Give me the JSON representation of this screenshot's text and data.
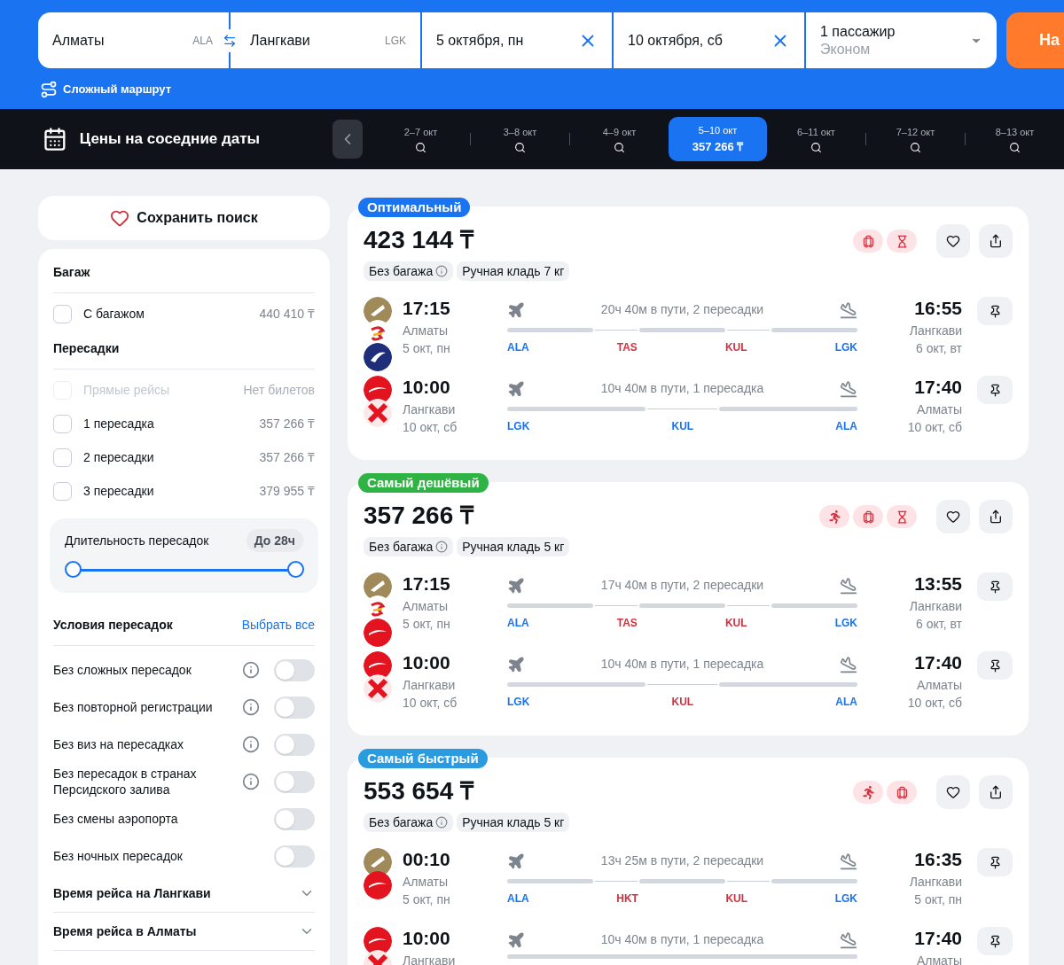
{
  "search": {
    "origin": {
      "city": "Алматы",
      "code": "ALA"
    },
    "destination": {
      "city": "Лангкави",
      "code": "LGK"
    },
    "date_there": "5 октября, пн",
    "date_back": "10 октября, сб",
    "passengers": "1 пассажир",
    "cabin": "Эконом",
    "submit": "На",
    "complex_route": "Сложный маршрут"
  },
  "dates_bar": {
    "title": "Цены на соседние даты",
    "dates": [
      {
        "label": "2–7 окт",
        "selected": false
      },
      {
        "label": "3–8 окт",
        "selected": false
      },
      {
        "label": "4–9 окт",
        "selected": false
      },
      {
        "label": "5–10 окт",
        "price": "357 266 ₸",
        "selected": true
      },
      {
        "label": "6–11 окт",
        "selected": false
      },
      {
        "label": "7–12 окт",
        "selected": false
      },
      {
        "label": "8–13 окт",
        "selected": false
      }
    ]
  },
  "sidebar": {
    "save_search": "Сохранить поиск",
    "baggage": {
      "title": "Багаж",
      "options": [
        {
          "label": "С багажом",
          "price": "440 410 ₸",
          "checked": false,
          "disabled": false
        }
      ]
    },
    "transfers": {
      "title": "Пересадки",
      "options": [
        {
          "label": "Прямые рейсы",
          "price": "Нет билетов",
          "checked": false,
          "disabled": true
        },
        {
          "label": "1 пересадка",
          "price": "357 266 ₸",
          "checked": false,
          "disabled": false
        },
        {
          "label": "2 пересадки",
          "price": "357 266 ₸",
          "checked": false,
          "disabled": false
        },
        {
          "label": "3 пересадки",
          "price": "379 955 ₸",
          "checked": false,
          "disabled": false
        }
      ]
    },
    "duration": {
      "label": "Длительность пересадок",
      "value": "До 28ч",
      "thumbs": [
        {
          "level": 0
        },
        {
          "level": 1
        }
      ]
    },
    "conditions": {
      "title": "Условия пересадок",
      "select_all": "Выбрать все",
      "items": [
        {
          "label": "Без сложных пересадок",
          "info": true,
          "on": false
        },
        {
          "label": "Без повторной регистрации",
          "info": true,
          "on": false
        },
        {
          "label": "Без виз на пересадках",
          "info": true,
          "on": false
        },
        {
          "label": "Без пересадок в странах Персидского залива",
          "info": true,
          "on": false
        },
        {
          "label": "Без смены аэропорта",
          "info": false,
          "on": false
        },
        {
          "label": "Без ночных пересадок",
          "info": false,
          "on": false
        }
      ]
    },
    "sections": [
      {
        "title": "Время рейса на Лангкави",
        "expanded": false
      },
      {
        "title": "Время рейса в Алматы",
        "expanded": false
      }
    ]
  },
  "results": [
    {
      "tag": "Оптимальный",
      "color": "#1a73f0",
      "price": "423 144 ₸",
      "warnings": [
        {
          "kind": "luggage"
        },
        {
          "kind": "hourglass"
        }
      ],
      "chips": [
        "Без багажа",
        "Ручная кладь 7 кг"
      ],
      "legs": [
        {
          "logos": [
            {
              "kind": "gold"
            },
            {
              "kind": "swirl"
            },
            {
              "kind": "navy"
            }
          ],
          "dep_time": "17:15",
          "dep_city": "Алматы",
          "dep_date": "5 окт, пн",
          "duration": "20ч 40м в пути, 2 пересадки",
          "arr_time": "16:55",
          "arr_city": "Лангкави",
          "arr_date": "6 окт, вт",
          "codes": [
            {
              "code": "ALA",
              "color": "#1a73f0"
            },
            {
              "code": "TAS",
              "color": "#d0333f"
            },
            {
              "code": "KUL",
              "color": "#d0333f"
            },
            {
              "code": "LGK",
              "color": "#1a73f0"
            }
          ]
        },
        {
          "logos": [
            {
              "kind": "red"
            },
            {
              "kind": "redx"
            }
          ],
          "dep_time": "10:00",
          "dep_city": "Лангкави",
          "dep_date": "10 окт, сб",
          "duration": "10ч 40м в пути, 1 пересадка",
          "arr_time": "17:40",
          "arr_city": "Алматы",
          "arr_date": "10 окт, сб",
          "codes": [
            {
              "code": "LGK",
              "color": "#1a73f0"
            },
            {
              "code": "KUL",
              "color": "#1a73f0"
            },
            {
              "code": "ALA",
              "color": "#1a73f0"
            }
          ]
        }
      ]
    },
    {
      "tag": "Самый дешёвый",
      "color": "#2fb344",
      "price": "357 266 ₸",
      "warnings": [
        {
          "kind": "run"
        },
        {
          "kind": "luggage"
        },
        {
          "kind": "hourglass"
        }
      ],
      "chips": [
        "Без багажа",
        "Ручная кладь 5 кг"
      ],
      "legs": [
        {
          "logos": [
            {
              "kind": "gold"
            },
            {
              "kind": "swirl"
            },
            {
              "kind": "red"
            }
          ],
          "dep_time": "17:15",
          "dep_city": "Алматы",
          "dep_date": "5 окт, пн",
          "duration": "17ч 40м в пути, 2 пересадки",
          "arr_time": "13:55",
          "arr_city": "Лангкави",
          "arr_date": "6 окт, вт",
          "codes": [
            {
              "code": "ALA",
              "color": "#1a73f0"
            },
            {
              "code": "TAS",
              "color": "#d0333f"
            },
            {
              "code": "KUL",
              "color": "#d0333f"
            },
            {
              "code": "LGK",
              "color": "#1a73f0"
            }
          ]
        },
        {
          "logos": [
            {
              "kind": "red"
            },
            {
              "kind": "redx"
            }
          ],
          "dep_time": "10:00",
          "dep_city": "Лангкави",
          "dep_date": "10 окт, сб",
          "duration": "10ч 40м в пути, 1 пересадка",
          "arr_time": "17:40",
          "arr_city": "Алматы",
          "arr_date": "10 окт, сб",
          "codes": [
            {
              "code": "LGK",
              "color": "#1a73f0"
            },
            {
              "code": "KUL",
              "color": "#d0333f"
            },
            {
              "code": "ALA",
              "color": "#1a73f0"
            }
          ]
        }
      ]
    },
    {
      "tag": "Самый быстрый",
      "color": "#2b9be0",
      "price": "553 654 ₸",
      "warnings": [
        {
          "kind": "run"
        },
        {
          "kind": "luggage"
        }
      ],
      "chips": [
        "Без багажа",
        "Ручная кладь 5 кг"
      ],
      "legs": [
        {
          "logos": [
            {
              "kind": "gold"
            },
            {
              "kind": "red"
            }
          ],
          "dep_time": "00:10",
          "dep_city": "Алматы",
          "dep_date": "5 окт, пн",
          "duration": "13ч 25м в пути, 2 пересадки",
          "arr_time": "16:35",
          "arr_city": "Лангкави",
          "arr_date": "5 окт, пн",
          "codes": [
            {
              "code": "ALA",
              "color": "#1a73f0"
            },
            {
              "code": "HKT",
              "color": "#d0333f"
            },
            {
              "code": "KUL",
              "color": "#d0333f"
            },
            {
              "code": "LGK",
              "color": "#1a73f0"
            }
          ]
        },
        {
          "logos": [
            {
              "kind": "red"
            },
            {
              "kind": "redx"
            }
          ],
          "dep_time": "10:00",
          "dep_city": "Лангкави",
          "duration": "10ч 40м в пути, 1 пересадка",
          "arr_time": "17:40",
          "arr_city": "Алматы"
        }
      ]
    }
  ]
}
